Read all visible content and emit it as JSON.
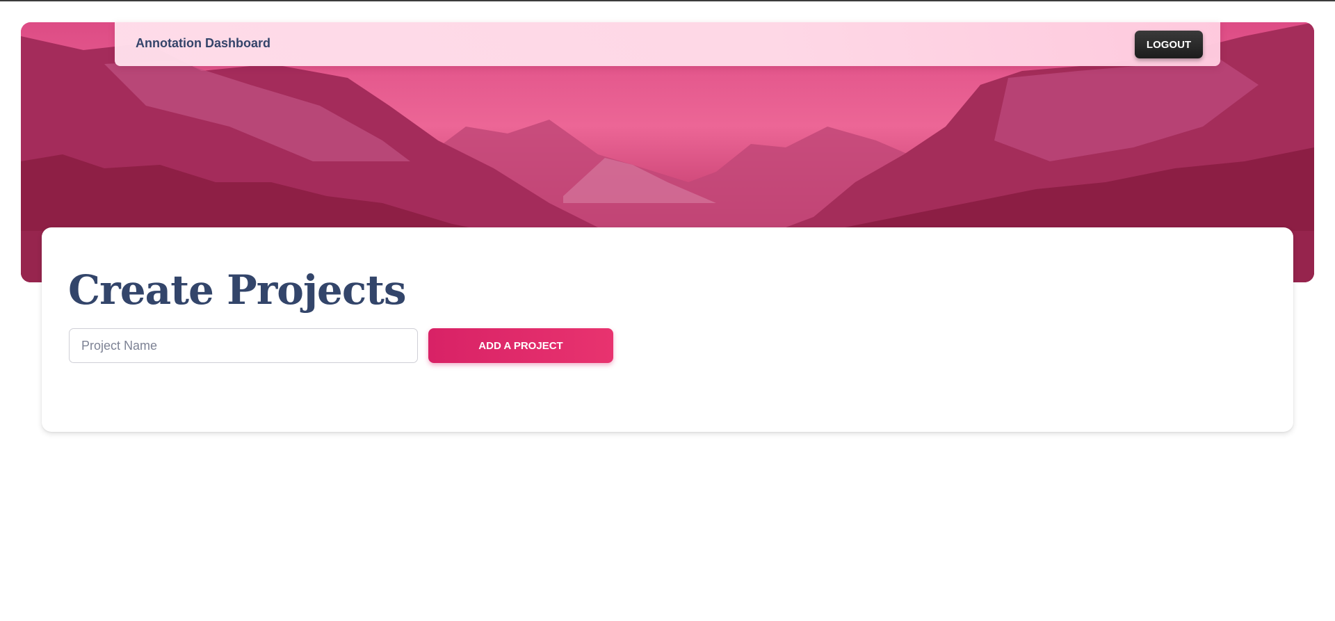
{
  "header": {
    "brand": "Annotation Dashboard",
    "logout_label": "LOGOUT"
  },
  "main": {
    "title": "Create Projects",
    "project_input": {
      "value": "",
      "placeholder": "Project Name"
    },
    "add_button_label": "ADD A PROJECT"
  },
  "icons": {
    "hero": "mountain-landscape-image"
  },
  "colors": {
    "accent": "#e0296a",
    "title": "#33456a",
    "hero_tint": "#c93a72",
    "logout_bg": "#222222"
  }
}
